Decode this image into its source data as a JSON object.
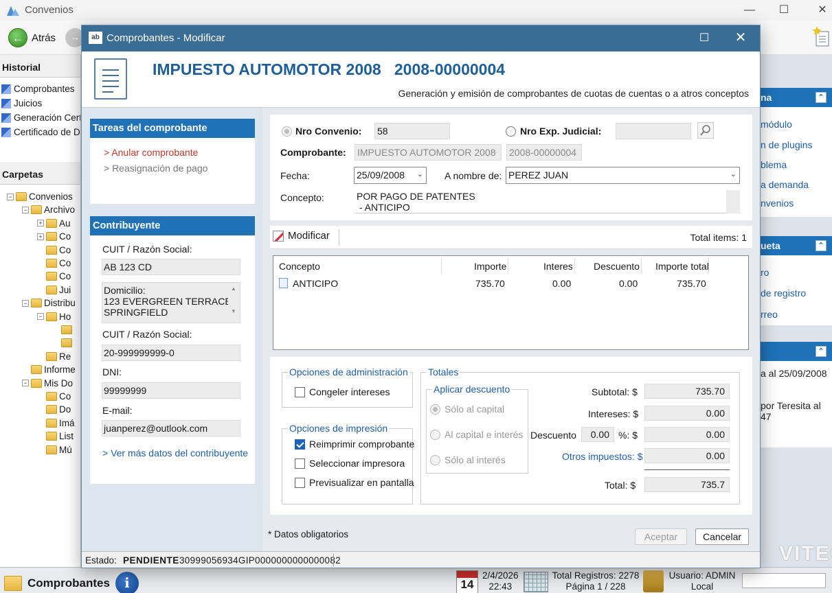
{
  "main_window": {
    "title": "Convenios",
    "back_label": "Atrás",
    "history": {
      "header": "Historial",
      "items": [
        "Comprobantes",
        "Juicios",
        "Generación Cert",
        "Certificado de De"
      ]
    },
    "folders": {
      "header": "Carpetas",
      "tree": [
        {
          "label": "Convenios",
          "indent": 0,
          "expander": "−"
        },
        {
          "label": "Archivo",
          "indent": 1,
          "expander": "−"
        },
        {
          "label": "Au",
          "indent": 2,
          "expander": "+"
        },
        {
          "label": "Co",
          "indent": 2,
          "expander": "+"
        },
        {
          "label": "Co",
          "indent": 2,
          "expander": ""
        },
        {
          "label": "Co",
          "indent": 2,
          "expander": ""
        },
        {
          "label": "Co",
          "indent": 2,
          "expander": ""
        },
        {
          "label": "Jui",
          "indent": 2,
          "expander": ""
        },
        {
          "label": "Distribu",
          "indent": 1,
          "expander": "−"
        },
        {
          "label": "Ho",
          "indent": 2,
          "expander": "−"
        },
        {
          "label": "",
          "indent": 3,
          "expander": ""
        },
        {
          "label": "",
          "indent": 3,
          "expander": ""
        },
        {
          "label": "Re",
          "indent": 2,
          "expander": ""
        },
        {
          "label": "Informe",
          "indent": 1,
          "expander": ""
        },
        {
          "label": "Mis Do",
          "indent": 1,
          "expander": "−"
        },
        {
          "label": "Co",
          "indent": 2,
          "expander": ""
        },
        {
          "label": "Do",
          "indent": 2,
          "expander": ""
        },
        {
          "label": "Imá",
          "indent": 2,
          "expander": ""
        },
        {
          "label": "List",
          "indent": 2,
          "expander": ""
        },
        {
          "label": "Mú",
          "indent": 2,
          "expander": ""
        }
      ]
    },
    "right_panels": [
      {
        "header": "na",
        "links": [
          "módulo",
          "n de plugins",
          "blema",
          "a demanda",
          "nvenios"
        ]
      },
      {
        "header": "ueta",
        "links": [
          "ro",
          "de registro",
          "rreo"
        ]
      },
      {
        "header": "",
        "texts": [
          "a al 25/09/2008",
          "por Teresita al",
          "47"
        ]
      }
    ],
    "brand": "VITEC",
    "taskbar": {
      "module": "Comprobantes",
      "calendar_day": "14",
      "date": "2/4/2026",
      "time": "22:43",
      "total_registros": "Total Registros: 2278",
      "pagina": "Página 1 / 228",
      "usuario": "Usuario: ADMIN",
      "ubicacion": "Local"
    }
  },
  "dialog": {
    "title": "Comprobantes - Modificar",
    "icon_text": "ab",
    "heading": "IMPUESTO AUTOMOTOR 2008   2008-00000004",
    "subheading": "Generación y emisión de comprobantes de cuotas de cuentas o a atros conceptos",
    "tasks": {
      "header": "Tareas del comprobante",
      "items": [
        "> Anular comprobante",
        "> Reasignación de pago"
      ]
    },
    "contribuyente": {
      "header": "Contribuyente",
      "cuit_label_1": "CUIT / Razón Social:",
      "cuit_value_1": "AB 123 CD",
      "domicilio": "Domicilio:\n123 EVERGREEN TERRACE,\nSPRINGFIELD",
      "cuit_label_2": "CUIT / Razón Social:",
      "cuit_value_2": "20-999999999-0",
      "dni_label": "DNI:",
      "dni_value": "99999999",
      "email_label": "E-mail:",
      "email_value": "juanperez@outlook.com",
      "more_link": "> Ver más datos del contribuyente"
    },
    "form": {
      "nro_convenio_label": "Nro Convenio:",
      "nro_convenio_value": "58",
      "nro_exp_label": "Nro Exp. Judicial:",
      "nro_exp_value": "",
      "comprobante_label": "Comprobante:",
      "comprobante_value": "IMPUESTO AUTOMOTOR 2008",
      "comprobante_nro": "2008-00000004",
      "fecha_label": "Fecha:",
      "fecha_value": "25/09/2008",
      "a_nombre_label": "A nombre de:",
      "a_nombre_value": "PEREZ JUAN",
      "concepto_label": "Concepto:",
      "concepto_value": "POR PAGO DE PATENTES\n - ANTICIPO"
    },
    "items_toolbar": {
      "modify_label": "Modificar",
      "total_items": "Total items: 1"
    },
    "items_table": {
      "columns": [
        "Concepto",
        "Importe",
        "Interes",
        "Descuento",
        "Importe total"
      ],
      "rows": [
        {
          "concepto": "ANTICIPO",
          "importe": "735.70",
          "interes": "0.00",
          "descuento": "0.00",
          "importe_total": "735.70"
        }
      ]
    },
    "options": {
      "admin_title": "Opciones de administración",
      "congelar": "Congeler intereses",
      "congelar_checked": false,
      "print_title": "Opciones de impresión",
      "reimprimir": "Reimprimir comprobante",
      "reimprimir_checked": true,
      "seleccionar": "Seleccionar impresora",
      "seleccionar_checked": false,
      "previsualizar": "Previsualizar en pantalla",
      "previsualizar_checked": false
    },
    "totales": {
      "title": "Totales",
      "descuento_group_title": "Aplicar descuento",
      "descuento_options": [
        "Sólo al capital",
        "Al capital e interés",
        "Sólo al interés"
      ],
      "descuento_selected": 0,
      "subtotal_label": "Subtotal: $",
      "subtotal_value": "735.70",
      "intereses_label": "Intereses: $",
      "intereses_value": "0.00",
      "descuento_label": "Descuento",
      "descuento_pct": "0.00",
      "descuento_pct_suffix": "%: $",
      "descuento_value": "0.00",
      "otros_label": "Otros impuestos: $",
      "otros_value": "0.00",
      "total_label": "Total: $",
      "total_value": "735.7"
    },
    "required_note": "* Datos obligatorios",
    "accept_label": "Aceptar",
    "cancel_label": "Cancelar",
    "status": {
      "label": "Estado:",
      "value": "PENDIENTE",
      "code": "30999056934GIP0000000000000082"
    }
  }
}
